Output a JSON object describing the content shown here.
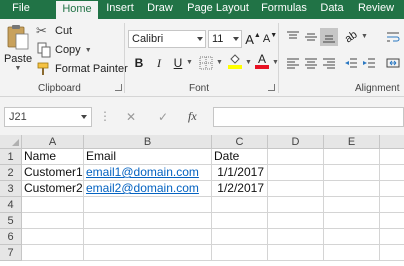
{
  "tabs": [
    {
      "label": "File",
      "active": false
    },
    {
      "label": "Home",
      "active": true
    },
    {
      "label": "Insert",
      "active": false
    },
    {
      "label": "Draw",
      "active": false
    },
    {
      "label": "Page Layout",
      "active": false
    },
    {
      "label": "Formulas",
      "active": false
    },
    {
      "label": "Data",
      "active": false
    },
    {
      "label": "Review",
      "active": false
    }
  ],
  "clipboard": {
    "paste_label": "Paste",
    "cut_label": "Cut",
    "copy_label": "Copy",
    "format_painter_label": "Format Painter",
    "group_label": "Clipboard"
  },
  "font": {
    "font_name": "Calibri",
    "font_size": "11",
    "bold_label": "B",
    "italic_label": "I",
    "underline_label": "U",
    "grow_label": "A",
    "shrink_label": "A",
    "font_color_label": "A",
    "group_label": "Font",
    "highlight_color": "#ffff00",
    "font_color": "#e81123"
  },
  "alignment": {
    "group_label": "Alignment"
  },
  "formula_bar": {
    "name_box": "J21",
    "cancel_symbol": "✕",
    "enter_symbol": "✓",
    "fx_label": "fx",
    "formula_value": ""
  },
  "sheet": {
    "columns": [
      "A",
      "B",
      "C",
      "D",
      "E"
    ],
    "rows": [
      "1",
      "2",
      "3",
      "4",
      "5",
      "6",
      "7"
    ],
    "cells": {
      "A1": "Name",
      "B1": "Email",
      "C1": "Date",
      "A2": "Customer1",
      "B2": "email1@domain.com",
      "C2": "1/1/2017",
      "A3": "Customer2",
      "B3": "email2@domain.com",
      "C3": "1/2/2017"
    }
  },
  "colors": {
    "accent": "#217346",
    "link": "#0563c1"
  }
}
